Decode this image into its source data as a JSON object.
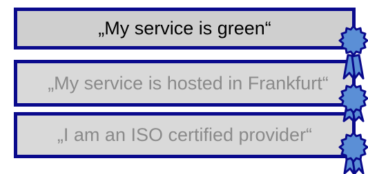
{
  "claims": [
    {
      "text": "„My service is green“",
      "highlighted": true
    },
    {
      "text": "„My service is hosted in Frankfurt“",
      "highlighted": false
    },
    {
      "text": "„I am an ISO certified provider“",
      "highlighted": false
    }
  ],
  "colors": {
    "border": "#0a0a8c",
    "box_fill": "#d9d9d9",
    "highlight_text": "#000000",
    "muted_text": "#8a8a8a",
    "seal_fill": "#5b8fd6",
    "seal_outline": "#0a0a8c"
  },
  "seal_icon": "rosette-award-icon"
}
